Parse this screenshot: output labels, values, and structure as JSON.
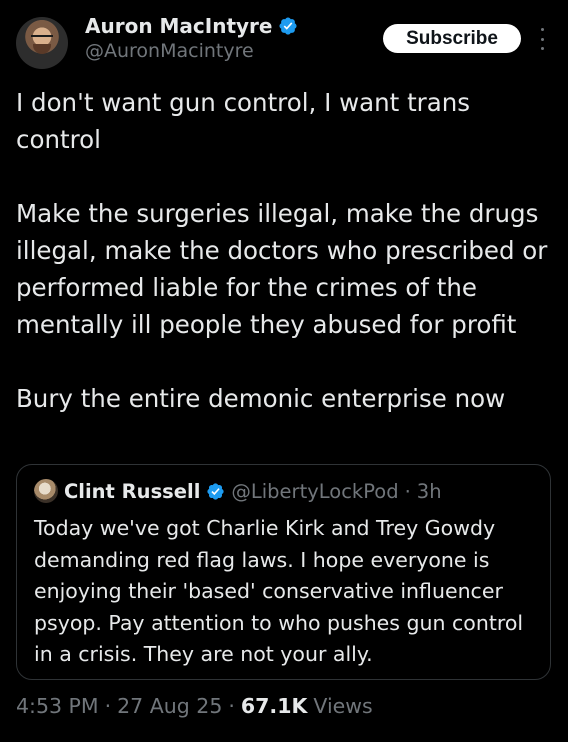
{
  "author": {
    "display_name": "Auron MacIntyre",
    "handle": "@AuronMacintyre",
    "verified_icon": "verified-badge-icon"
  },
  "actions": {
    "subscribe_label": "Subscribe",
    "more_icon": "more-options-icon"
  },
  "tweet": {
    "paragraphs": [
      "I don't want gun control, I want trans control",
      "Make the surgeries illegal, make the drugs illegal, make the doctors who prescribed or performed liable for the crimes of the mentally ill people they abused for profit",
      "Bury the entire demonic enterprise now"
    ]
  },
  "quoted_tweet": {
    "display_name": "Clint Russell",
    "handle": "@LibertyLockPod",
    "separator": "·",
    "time": "3h",
    "text": "Today we've got Charlie Kirk and Trey Gowdy demanding red flag laws. I hope everyone is enjoying their 'based' conservative influencer psyop. Pay attention to who pushes gun control in a crisis. They are not your ally."
  },
  "meta": {
    "time": "4:53 PM",
    "separator": "·",
    "date": "27 Aug 25",
    "views_count": "67.1K",
    "views_label": "Views"
  },
  "colors": {
    "background": "#000000",
    "text": "#e7e9ea",
    "secondary": "#71767b",
    "verified": "#1d9bf0"
  }
}
